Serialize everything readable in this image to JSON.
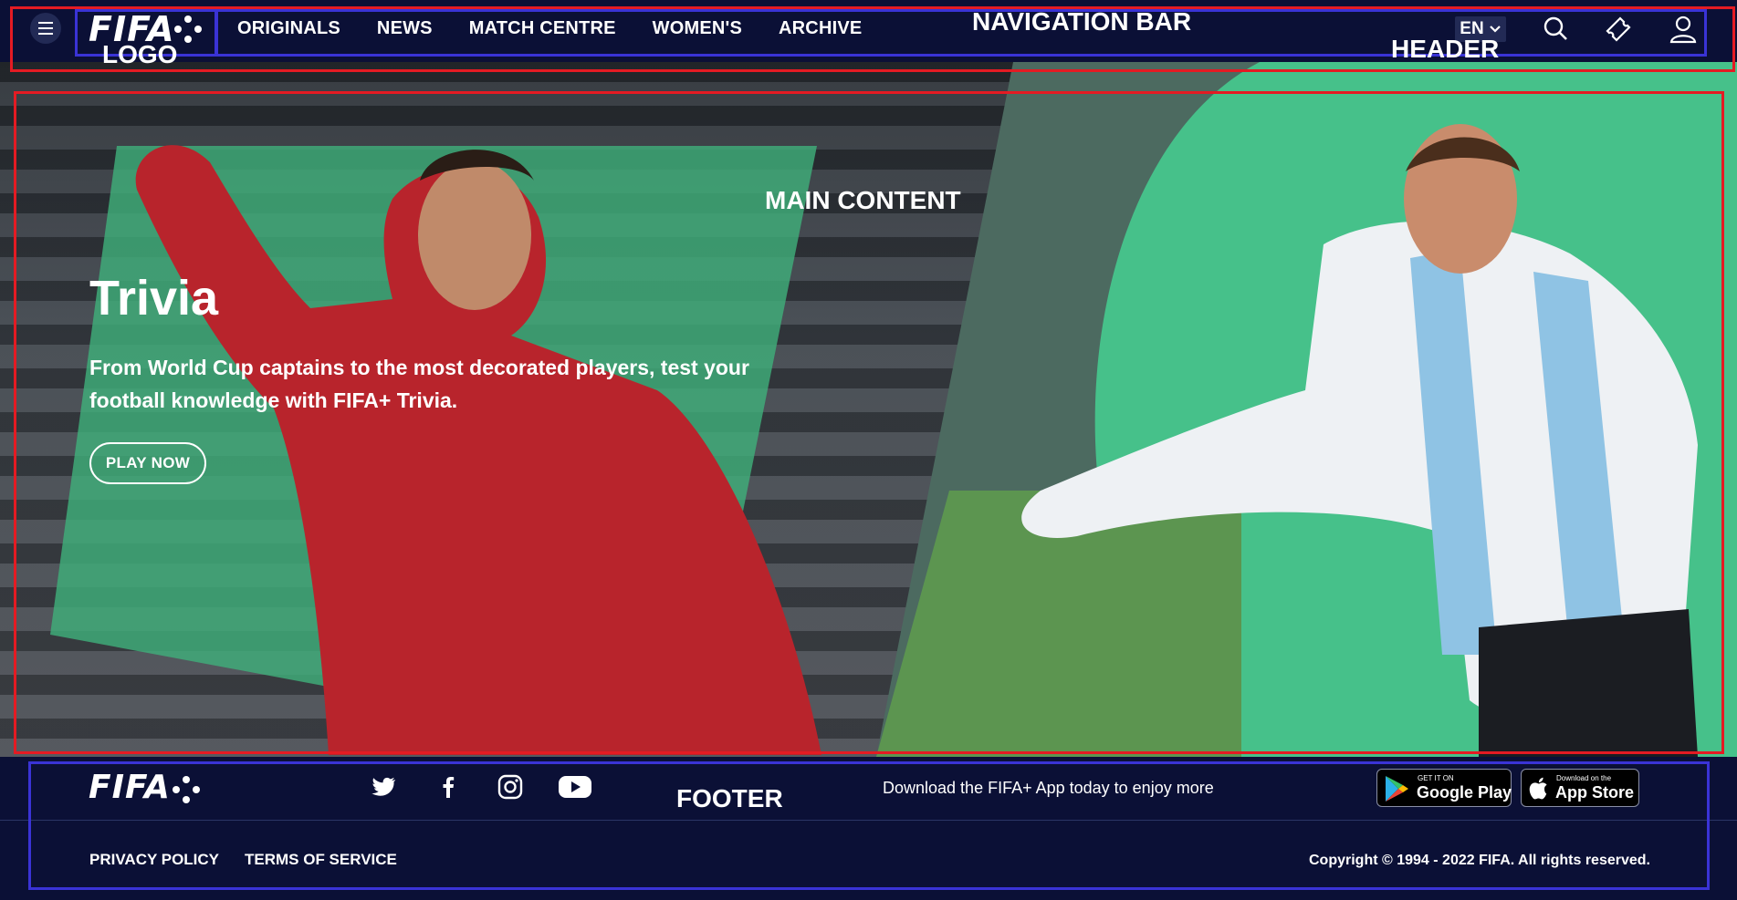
{
  "header": {
    "logo_text": "FIFA",
    "nav_items": [
      {
        "label": "ORIGINALS"
      },
      {
        "label": "NEWS"
      },
      {
        "label": "MATCH CENTRE"
      },
      {
        "label": "WOMEN'S"
      },
      {
        "label": "ARCHIVE"
      }
    ],
    "language": "EN",
    "icons": [
      "menu-icon",
      "search-icon",
      "ticket-icon",
      "user-icon"
    ]
  },
  "annotations": {
    "logo": "LOGO",
    "navigation_bar": "NAVIGATION BAR",
    "header": "HEADER",
    "main_content": "MAIN CONTENT",
    "footer": "FOOTER"
  },
  "hero": {
    "title": "Trivia",
    "description": "From World Cup captains to the most decorated players, test your football knowledge with FIFA+ Trivia.",
    "cta_label": "PLAY NOW"
  },
  "footer": {
    "logo_text": "FIFA",
    "social_icons": [
      "twitter-icon",
      "facebook-icon",
      "instagram-icon",
      "youtube-icon"
    ],
    "app_promo": "Download the FIFA+ App today to enjoy more",
    "google_play": {
      "small": "GET IT ON",
      "big": "Google Play"
    },
    "app_store": {
      "small": "Download on the",
      "big": "App Store"
    },
    "links": [
      {
        "label": "PRIVACY POLICY"
      },
      {
        "label": "TERMS OF SERVICE"
      }
    ],
    "copyright": "Copyright © 1994 - 2022 FIFA. All rights reserved."
  },
  "colors": {
    "navy": "#0b1036",
    "accent_green": "#3fbf7f",
    "annotation_red": "#e41b23",
    "annotation_blue": "#3a33d6"
  }
}
